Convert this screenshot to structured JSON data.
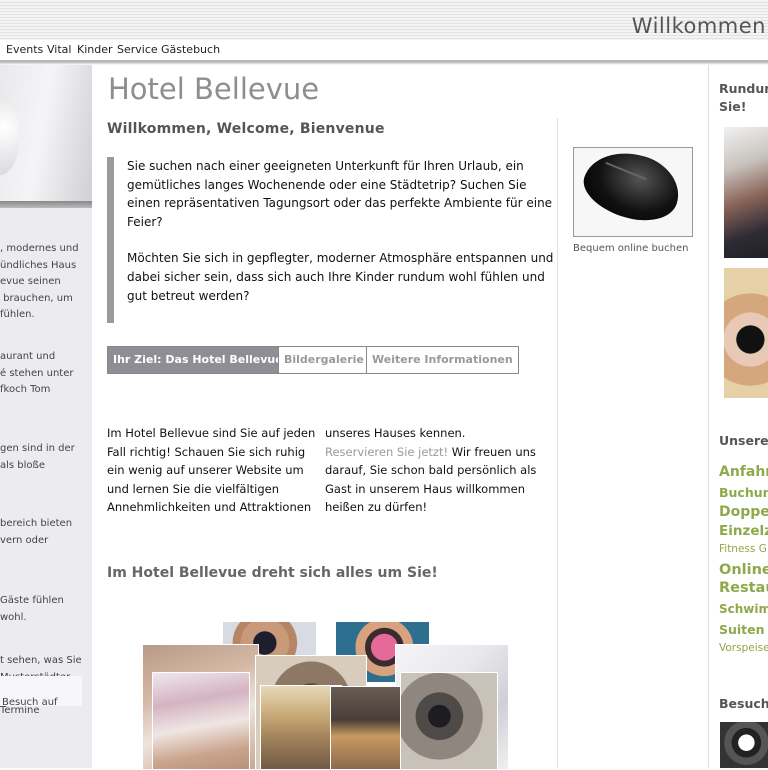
{
  "header": {
    "welcome": "Willkommen"
  },
  "nav": {
    "items": [
      "Events",
      "Vital",
      "Kinder",
      "Service",
      "Gästebuch"
    ]
  },
  "left": {
    "paragraphs": [
      ", modernes und\nündliches Haus\nevue seinen\n brauchen, um\nfühlen.",
      "aurant und\né stehen unter\nfkoch Tom",
      "gen sind in der\nals bloße",
      "bereich bieten\nvern oder",
      "Gäste fühlen\nwohl.",
      "t sehen, was Sie\nMusterstädter\nkönnen, haben\nTermine"
    ],
    "bottom": "Besuch auf"
  },
  "main": {
    "title": "Hotel Bellevue",
    "subtitle": "Willkommen, Welcome, Bienvenue",
    "quote_p1": "Sie suchen nach einer geeigneten Unterkunft für Ihren Urlaub, ein gemütliches langes Wochenende oder eine Städtetrip? Suchen Sie einen repräsentativen Tagungsort oder das perfekte Ambiente für eine Feier?",
    "quote_p2": "Möchten Sie sich in gepflegter, moderner Atmosphäre entspannen und dabei sicher sein, dass sich auch Ihre Kinder rundum wohl fühlen und gut betreut werden?",
    "promo_caption": "Bequem online buchen",
    "tabs": [
      "Ihr Ziel: Das Hotel Bellevue",
      "Bildergalerie",
      "Weitere Informationen"
    ],
    "col1": "Im Hotel Bellevue sind Sie auf jeden Fall richtig! Schauen Sie sich ruhig ein wenig auf unserer Website um und lernen Sie die vielfältigen Annehmlichkeiten und Attraktionen",
    "col2_start": "unseres Hauses kennen. ",
    "col2_link": "Reservieren Sie jetzt!",
    "col2_end": " Wir freuen uns darauf, Sie schon bald persönlich als Gast in unserem Haus willkommen heißen zu dürfen!",
    "section2": "Im Hotel Bellevue dreht sich alles um Sie!"
  },
  "right": {
    "heading": "Rundum\nSie!",
    "section": "Unsere l",
    "links": [
      "Anfahrt",
      "Buchung",
      "Doppel",
      "Einzelzi",
      "Fitness G",
      "Online-",
      "Restau",
      "Schwimm",
      "Suiten T",
      "Vorspeise"
    ],
    "section2": "Besuche"
  },
  "colors": {
    "accent_green": "#8fa84a",
    "tab_active": "#8e8e94",
    "title_gray": "#8e8e92"
  }
}
